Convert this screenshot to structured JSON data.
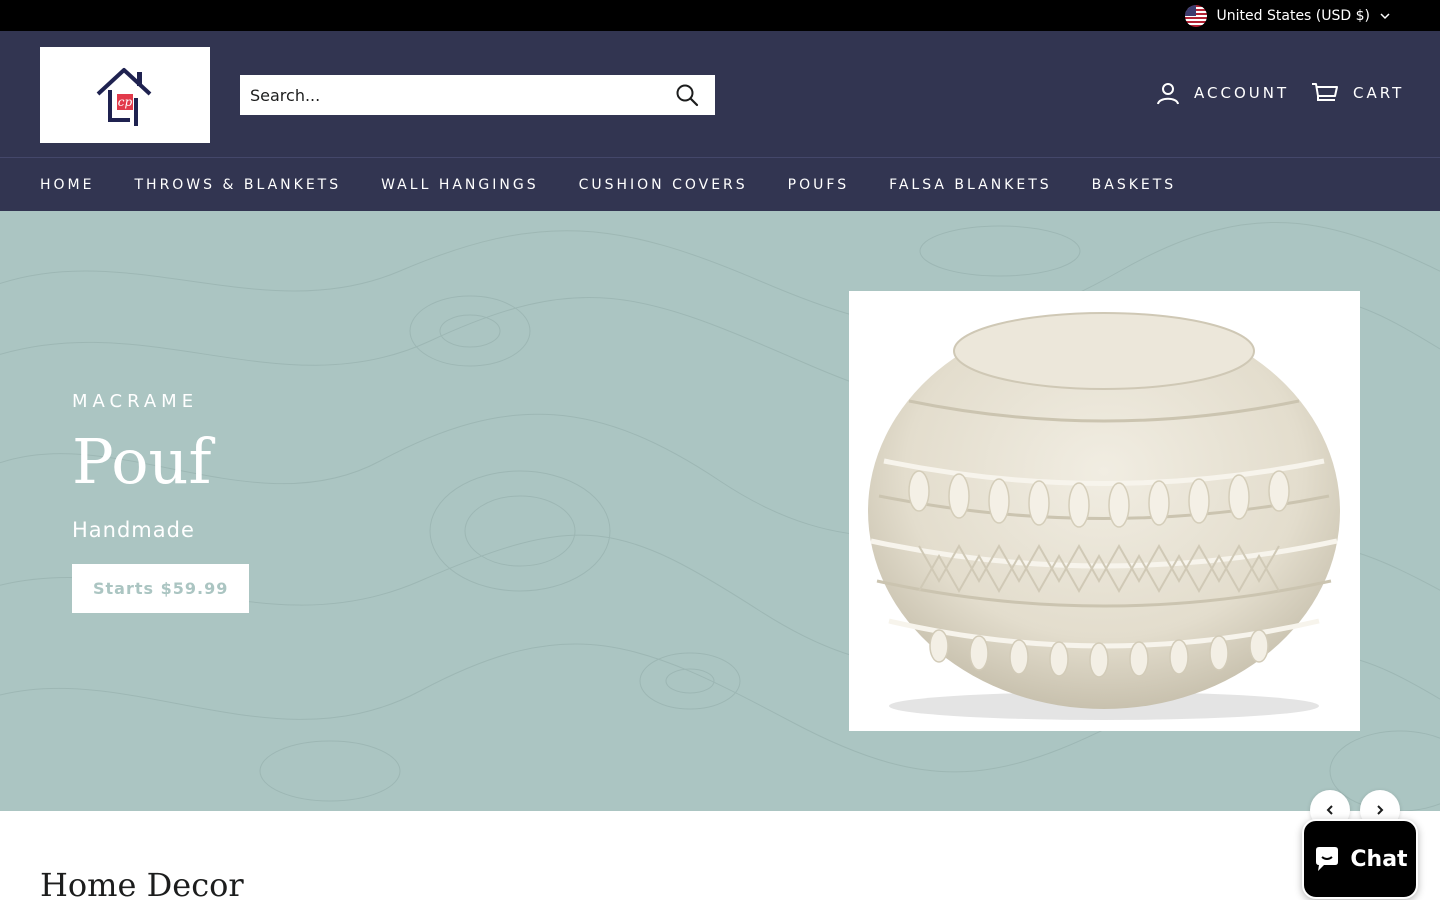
{
  "topbar": {
    "currency_label": "United States (USD $)"
  },
  "header": {
    "search_placeholder": "Search...",
    "account_label": "ACCOUNT",
    "cart_label": "CART"
  },
  "nav": {
    "items": [
      {
        "label": "HOME"
      },
      {
        "label": "THROWS & BLANKETS"
      },
      {
        "label": "WALL HANGINGS"
      },
      {
        "label": "CUSHION COVERS"
      },
      {
        "label": "POUFS"
      },
      {
        "label": "FALSA BLANKETS"
      },
      {
        "label": "BASKETS"
      }
    ]
  },
  "hero": {
    "eyebrow": "MACRAME",
    "title": "Pouf",
    "subtitle": "Handmade",
    "button_label": "Starts $59.99",
    "background_color": "#abc5c2"
  },
  "section": {
    "title": "Home Decor"
  },
  "chat": {
    "label": "Chat"
  },
  "colors": {
    "header_bg": "#323551",
    "topbar_bg": "#000000",
    "hero_bg": "#abc5c2"
  }
}
